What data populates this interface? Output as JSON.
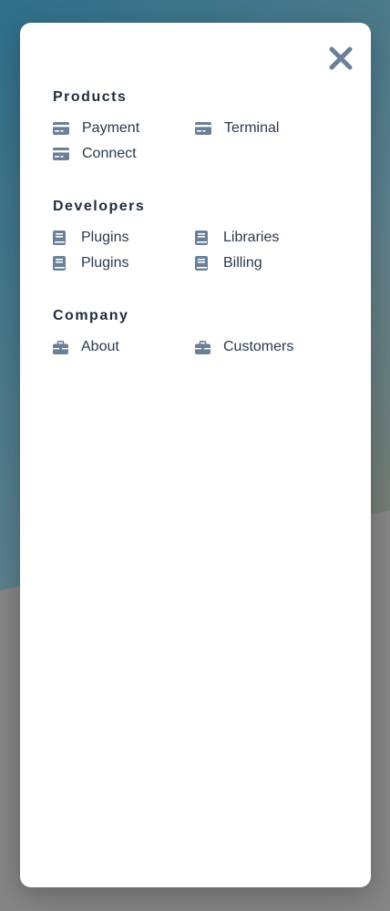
{
  "colors": {
    "icon": "#6a7f98",
    "heading": "#1f2d3d",
    "text": "#2a3a4d",
    "panel": "#ffffff",
    "backdrop_start": "#2f6f8a",
    "backdrop_end": "#8a7b5f",
    "grey_overlay": "#858585"
  },
  "close": {
    "icon": "close-icon"
  },
  "sections": [
    {
      "title": "Products",
      "icon": "credit-card-icon",
      "items": [
        {
          "label": "Payment"
        },
        {
          "label": "Terminal"
        },
        {
          "label": "Connect"
        }
      ]
    },
    {
      "title": "Developers",
      "icon": "book-icon",
      "items": [
        {
          "label": "Plugins"
        },
        {
          "label": "Libraries"
        },
        {
          "label": "Plugins"
        },
        {
          "label": "Billing"
        }
      ]
    },
    {
      "title": "Company",
      "icon": "briefcase-icon",
      "items": [
        {
          "label": "About"
        },
        {
          "label": "Customers"
        }
      ]
    }
  ]
}
